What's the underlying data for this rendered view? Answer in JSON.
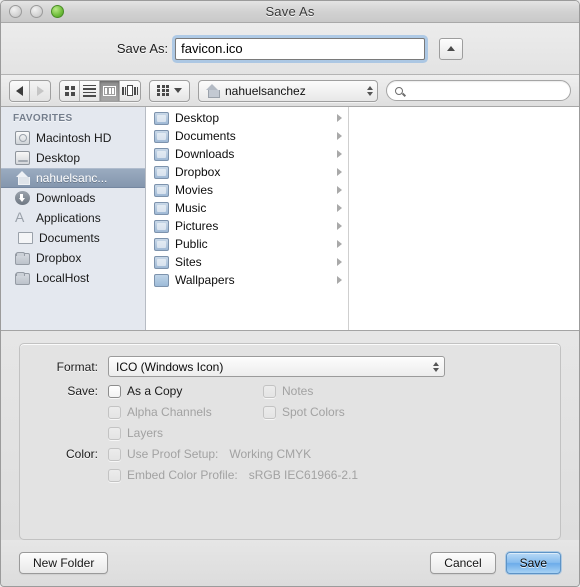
{
  "window": {
    "title": "Save As",
    "traffic_lights": [
      {
        "name": "close-button",
        "state": "inactive"
      },
      {
        "name": "minimize-button",
        "state": "inactive"
      },
      {
        "name": "zoom-button",
        "state": "active",
        "color": "#6fbd3b"
      }
    ]
  },
  "saveas": {
    "label": "Save As:",
    "value": "favicon.ico",
    "placeholder": "",
    "stepper_icon": "caret-up-icon"
  },
  "toolbar": {
    "nav": [
      {
        "name": "back-button",
        "icon": "triangle-left-icon",
        "enabled": true
      },
      {
        "name": "forward-button",
        "icon": "triangle-right-icon",
        "enabled": false
      }
    ],
    "view_modes": [
      {
        "name": "icon-view-button",
        "icon": "grid-icon",
        "selected": false
      },
      {
        "name": "list-view-button",
        "icon": "list-icon",
        "selected": false
      },
      {
        "name": "column-view-button",
        "icon": "columns-icon",
        "selected": true
      },
      {
        "name": "coverflow-view-button",
        "icon": "coverflow-icon",
        "selected": false
      }
    ],
    "arrange": {
      "name": "arrange-button",
      "icon": "arrange-grid-icon",
      "chevron": "chevron-down-icon"
    },
    "path_popup": {
      "label": "nahuelsanchez",
      "icon": "home-icon",
      "chevron": "up-down-arrows-icon"
    },
    "search": {
      "placeholder": "",
      "value": "",
      "icon": "search-icon"
    }
  },
  "sidebar": {
    "header": "FAVORITES",
    "items": [
      {
        "label": "Macintosh HD",
        "icon": "harddisk-icon",
        "selected": false
      },
      {
        "label": "Desktop",
        "icon": "desktop-icon",
        "selected": false
      },
      {
        "label": "nahuelsanc...",
        "icon": "home-icon",
        "selected": true
      },
      {
        "label": "Downloads",
        "icon": "downloads-icon",
        "selected": false
      },
      {
        "label": "Applications",
        "icon": "applications-icon",
        "selected": false
      },
      {
        "label": "Documents",
        "icon": "documents-icon",
        "selected": false
      },
      {
        "label": "Dropbox",
        "icon": "folder-icon",
        "selected": false
      },
      {
        "label": "LocalHost",
        "icon": "folder-icon",
        "selected": false
      }
    ]
  },
  "file_column": {
    "rows": [
      {
        "name": "Desktop",
        "icon": "folder-desktop-icon",
        "disclosure": "triangle-right-icon"
      },
      {
        "name": "Documents",
        "icon": "folder-documents-icon",
        "disclosure": "triangle-right-icon"
      },
      {
        "name": "Downloads",
        "icon": "folder-downloads-icon",
        "disclosure": "triangle-right-icon"
      },
      {
        "name": "Dropbox",
        "icon": "folder-dropbox-icon",
        "disclosure": "triangle-right-icon"
      },
      {
        "name": "Movies",
        "icon": "folder-movies-icon",
        "disclosure": "triangle-right-icon"
      },
      {
        "name": "Music",
        "icon": "folder-music-icon",
        "disclosure": "triangle-right-icon"
      },
      {
        "name": "Pictures",
        "icon": "folder-pictures-icon",
        "disclosure": "triangle-right-icon"
      },
      {
        "name": "Public",
        "icon": "folder-public-icon",
        "disclosure": "triangle-right-icon"
      },
      {
        "name": "Sites",
        "icon": "folder-sites-icon",
        "disclosure": "triangle-right-icon"
      },
      {
        "name": "Wallpapers",
        "icon": "folder-icon",
        "disclosure": "triangle-right-icon"
      }
    ]
  },
  "options": {
    "format_label": "Format:",
    "format_value": "ICO (Windows Icon)",
    "save_label": "Save:",
    "color_label": "Color:",
    "save_checkboxes": [
      {
        "label": "As a Copy",
        "checked": false,
        "enabled": true
      },
      {
        "label": "Notes",
        "checked": false,
        "enabled": false
      },
      {
        "label": "Alpha Channels",
        "checked": false,
        "enabled": false
      },
      {
        "label": "Spot Colors",
        "checked": false,
        "enabled": false
      },
      {
        "label": "Layers",
        "checked": false,
        "enabled": false
      }
    ],
    "color_checkboxes": [
      {
        "label": "Use Proof Setup:",
        "value": "Working CMYK",
        "checked": false,
        "enabled": false
      },
      {
        "label": "Embed Color Profile:",
        "value": "sRGB IEC61966-2.1",
        "checked": false,
        "enabled": false
      }
    ]
  },
  "buttons": {
    "new_folder": "New Folder",
    "cancel": "Cancel",
    "save": "Save"
  }
}
